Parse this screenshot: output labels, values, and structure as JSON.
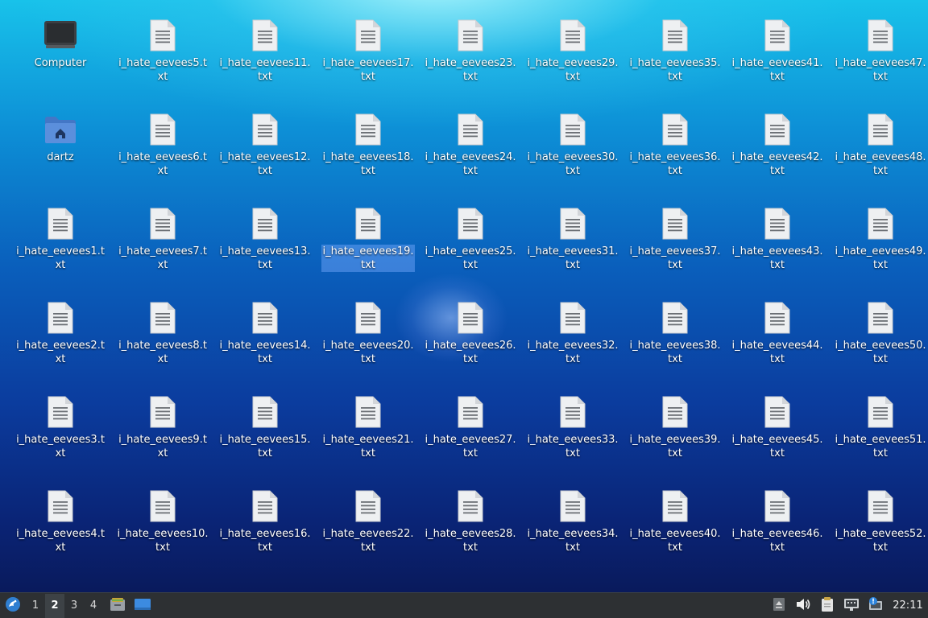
{
  "desktop": {
    "items": [
      {
        "label": "Computer",
        "type": "computer"
      },
      {
        "label": "dartz",
        "type": "home"
      },
      {
        "label": "i_hate_eevees1.txt",
        "type": "file"
      },
      {
        "label": "i_hate_eevees2.txt",
        "type": "file"
      },
      {
        "label": "i_hate_eevees3.txt",
        "type": "file"
      },
      {
        "label": "i_hate_eevees4.txt",
        "type": "file"
      },
      {
        "label": "i_hate_eevees5.txt",
        "type": "file"
      },
      {
        "label": "i_hate_eevees6.txt",
        "type": "file"
      },
      {
        "label": "i_hate_eevees7.txt",
        "type": "file"
      },
      {
        "label": "i_hate_eevees8.txt",
        "type": "file"
      },
      {
        "label": "i_hate_eevees9.txt",
        "type": "file"
      },
      {
        "label": "i_hate_eevees10.txt",
        "type": "file"
      },
      {
        "label": "i_hate_eevees11.txt",
        "type": "file"
      },
      {
        "label": "i_hate_eevees12.txt",
        "type": "file"
      },
      {
        "label": "i_hate_eevees13.txt",
        "type": "file"
      },
      {
        "label": "i_hate_eevees14.txt",
        "type": "file"
      },
      {
        "label": "i_hate_eevees15.txt",
        "type": "file"
      },
      {
        "label": "i_hate_eevees16.txt",
        "type": "file"
      },
      {
        "label": "i_hate_eevees17.txt",
        "type": "file"
      },
      {
        "label": "i_hate_eevees18.txt",
        "type": "file"
      },
      {
        "label": "i_hate_eevees19.txt",
        "type": "file",
        "selected": true
      },
      {
        "label": "i_hate_eevees20.txt",
        "type": "file"
      },
      {
        "label": "i_hate_eevees21.txt",
        "type": "file"
      },
      {
        "label": "i_hate_eevees22.txt",
        "type": "file"
      },
      {
        "label": "i_hate_eevees23.txt",
        "type": "file"
      },
      {
        "label": "i_hate_eevees24.txt",
        "type": "file"
      },
      {
        "label": "i_hate_eevees25.txt",
        "type": "file"
      },
      {
        "label": "i_hate_eevees26.txt",
        "type": "file"
      },
      {
        "label": "i_hate_eevees27.txt",
        "type": "file"
      },
      {
        "label": "i_hate_eevees28.txt",
        "type": "file"
      },
      {
        "label": "i_hate_eevees29.txt",
        "type": "file"
      },
      {
        "label": "i_hate_eevees30.txt",
        "type": "file"
      },
      {
        "label": "i_hate_eevees31.txt",
        "type": "file"
      },
      {
        "label": "i_hate_eevees32.txt",
        "type": "file"
      },
      {
        "label": "i_hate_eevees33.txt",
        "type": "file"
      },
      {
        "label": "i_hate_eevees34.txt",
        "type": "file"
      },
      {
        "label": "i_hate_eevees35.txt",
        "type": "file"
      },
      {
        "label": "i_hate_eevees36.txt",
        "type": "file"
      },
      {
        "label": "i_hate_eevees37.txt",
        "type": "file"
      },
      {
        "label": "i_hate_eevees38.txt",
        "type": "file"
      },
      {
        "label": "i_hate_eevees39.txt",
        "type": "file"
      },
      {
        "label": "i_hate_eevees40.txt",
        "type": "file"
      },
      {
        "label": "i_hate_eevees41.txt",
        "type": "file"
      },
      {
        "label": "i_hate_eevees42.txt",
        "type": "file"
      },
      {
        "label": "i_hate_eevees43.txt",
        "type": "file"
      },
      {
        "label": "i_hate_eevees44.txt",
        "type": "file"
      },
      {
        "label": "i_hate_eevees45.txt",
        "type": "file"
      },
      {
        "label": "i_hate_eevees46.txt",
        "type": "file"
      },
      {
        "label": "i_hate_eevees47.txt",
        "type": "file"
      },
      {
        "label": "i_hate_eevees48.txt",
        "type": "file"
      },
      {
        "label": "i_hate_eevees49.txt",
        "type": "file"
      },
      {
        "label": "i_hate_eevees50.txt",
        "type": "file"
      },
      {
        "label": "i_hate_eevees51.txt",
        "type": "file"
      },
      {
        "label": "i_hate_eevees52.txt",
        "type": "file"
      }
    ]
  },
  "taskbar": {
    "start_icon": "distro-logo-icon",
    "workspaces": [
      {
        "label": "1",
        "active": false
      },
      {
        "label": "2",
        "active": true
      },
      {
        "label": "3",
        "active": false
      },
      {
        "label": "4",
        "active": false
      }
    ],
    "quick_launch": [
      "file-manager-icon",
      "show-desktop-icon"
    ],
    "tray": [
      "tray-expand-icon",
      "volume-icon",
      "clipboard-icon",
      "network-icon",
      "update-notifier-icon"
    ],
    "clock": "22:11"
  },
  "colors": {
    "taskbar_bg": "#2d3033",
    "selection": "#78aaff",
    "accent": "#4a8fd8"
  }
}
